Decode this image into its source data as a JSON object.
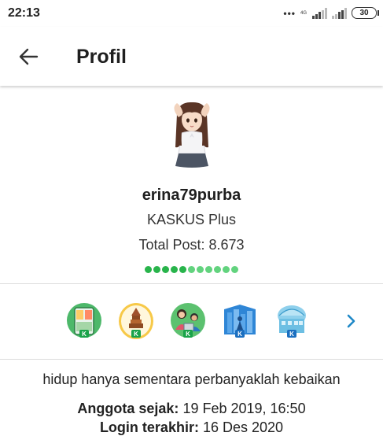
{
  "status_bar": {
    "time": "22:13",
    "network": "4G",
    "battery": "30"
  },
  "header": {
    "title": "Profil",
    "back_icon": "arrow-left-icon"
  },
  "profile": {
    "username": "erina79purba",
    "rank": "KASKUS Plus",
    "total_post": "Total Post: 8.673",
    "reputation": {
      "filled": 5,
      "total": 11,
      "filled_color": "#28b44b",
      "empty_color": "#62d37e"
    }
  },
  "badges": {
    "items": [
      {
        "icon": "kaskus-fridge-badge-icon"
      },
      {
        "icon": "kaskus-temple-badge-icon"
      },
      {
        "icon": "kaskus-family-badge-icon"
      },
      {
        "icon": "kaskus-city-badge-icon"
      },
      {
        "icon": "kaskus-building-badge-icon"
      }
    ],
    "next_icon": "chevron-right-icon",
    "accent": "#1e88c7"
  },
  "bio": "hidup hanya sementara perbanyaklah kebaikan",
  "member": {
    "since_label": "Anggota sejak:",
    "since_value": "19 Feb 2019, 16:50",
    "last_active_label": "Login terakhir:",
    "last_active_value": "16 Des 2020"
  }
}
